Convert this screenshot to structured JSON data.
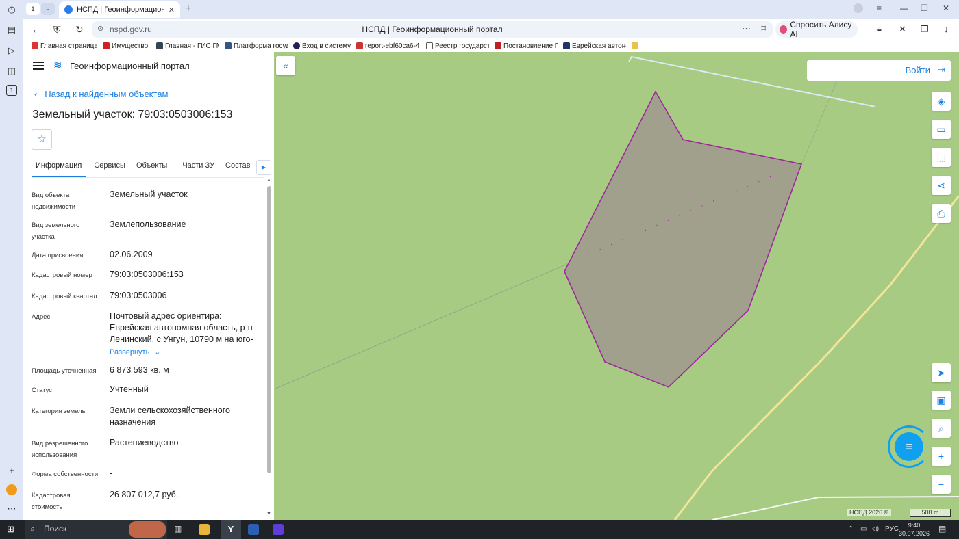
{
  "browser": {
    "tab_count": "1",
    "tab_title": "НСПД | Геоинформационный портал",
    "address_domain": "nspd.gov.ru",
    "page_title": "НСПД | Геоинформационный портал",
    "alice_label": "Спросить Алису AI",
    "bookmarks": [
      "Главная страница",
      "Имущество",
      "Главная - ГИС ГМ",
      "Платформа госуд",
      "Вход в систему",
      "report-ebf60ca6-4",
      "Реестр государст",
      "Постановление П",
      "Еврейская автоно"
    ]
  },
  "panel": {
    "portal_title": "Геоинформационный портал",
    "back_link": "Назад к найденным объектам",
    "heading": "Земельный участок: 79:03:0503006:153",
    "tabs": [
      "Информация",
      "Сервисы",
      "Объекты",
      "Части ЗУ",
      "Состав"
    ],
    "fields": [
      {
        "label": "Вид объекта недвижимости",
        "value": "Земельный участок"
      },
      {
        "label": "Вид земельного участка",
        "value": "Землепользование"
      },
      {
        "label": "Дата присвоения",
        "value": "02.06.2009"
      },
      {
        "label": "Кадастровый номер",
        "value": "79:03:0503006:153"
      },
      {
        "label": "Кадастровый квартал",
        "value": "79:03:0503006"
      },
      {
        "label": "Адрес",
        "value": "Почтовый адрес ориентира: Еврейская автономная область, р-н Ленинский, с Унгун, 10790 м на юго-"
      },
      {
        "label": "Площадь уточненная",
        "value": "6 873 593 кв. м"
      },
      {
        "label": "Статус",
        "value": "Учтенный"
      },
      {
        "label": "Категория земель",
        "value": "Земли сельскохозяйственного назначения"
      },
      {
        "label": "Вид разрешенного использования",
        "value": "Растениеводство"
      },
      {
        "label": "Форма собственности",
        "value": "-"
      },
      {
        "label": "Кадастровая стоимость",
        "value": "26 807 012,7 руб."
      }
    ],
    "expand_link": "Развернуть"
  },
  "map": {
    "login_label": "Войти",
    "attribution": "НСПД 2026 ©",
    "scale_label": "500 m",
    "land_color": "#a8cb84",
    "parcel_fill": "#a0a08c",
    "parcel_stroke": "#a0259e"
  },
  "taskbar": {
    "search_label": "Поиск",
    "lang": "РУС",
    "time": "9:40",
    "date": "30.07.2026"
  }
}
